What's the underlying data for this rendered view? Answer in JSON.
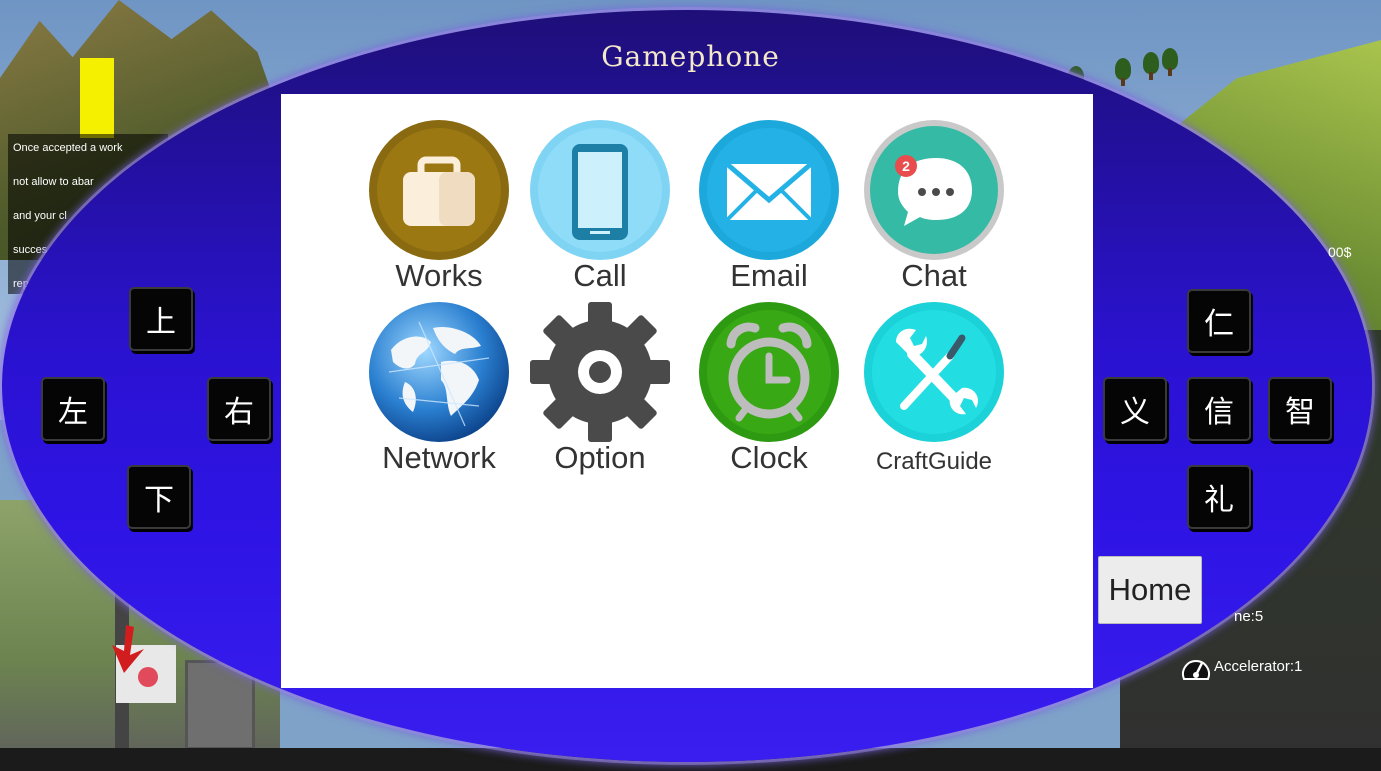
{
  "phone": {
    "title": "Gamephone",
    "colors": {
      "shell": "#2a12d0",
      "title": "#f3e9c9",
      "screen": "#ffffff"
    }
  },
  "apps": [
    {
      "label": "Works",
      "icon": "briefcase-icon"
    },
    {
      "label": "Call",
      "icon": "phone-icon"
    },
    {
      "label": "Email",
      "icon": "envelope-icon"
    },
    {
      "label": "Chat",
      "icon": "chat-icon",
      "badge": "2"
    },
    {
      "label": "Network",
      "icon": "globe-icon"
    },
    {
      "label": "Option",
      "icon": "gear-icon"
    },
    {
      "label": "Clock",
      "icon": "alarm-clock-icon"
    },
    {
      "label": "CraftGuide",
      "icon": "wrench-screwdriver-icon"
    }
  ],
  "dpad": {
    "up": "上",
    "down": "下",
    "left": "左",
    "right": "右"
  },
  "virtue_keys": {
    "ren": "仁",
    "yi": "义",
    "xin": "信",
    "zhi": "智",
    "li": "礼"
  },
  "home_button": "Home",
  "hud": {
    "mission_lines": [
      "Once accepted a work",
      "not allow to abar",
      "and your cl",
      "succes",
      "rep"
    ],
    "money_fragment": "00$",
    "time_fragment": "ne:5",
    "accelerator": "Accelerator:1"
  }
}
